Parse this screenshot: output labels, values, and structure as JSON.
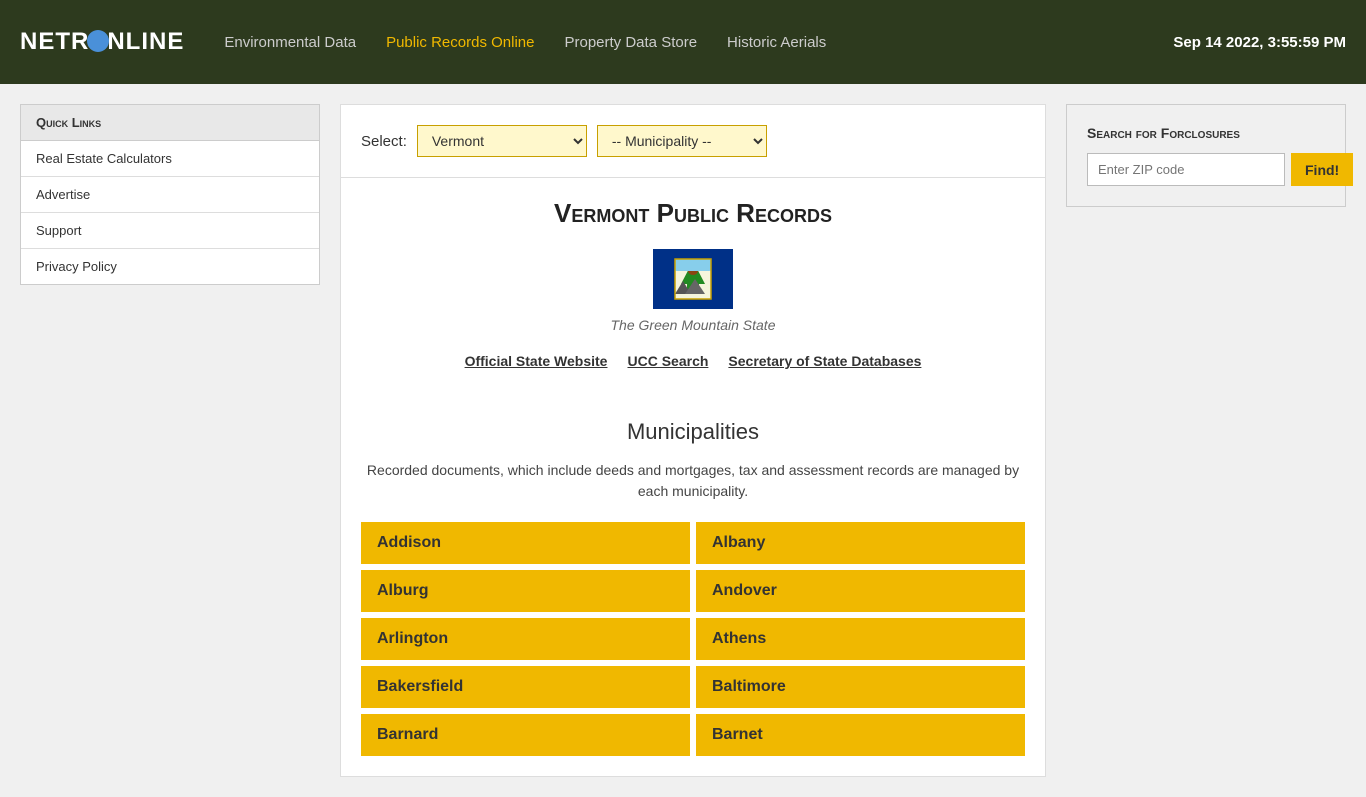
{
  "header": {
    "logo": "NETRONLINE",
    "datetime": "Sep 14 2022, 3:55:59 PM",
    "nav": [
      {
        "label": "Environmental Data",
        "active": false
      },
      {
        "label": "Public Records Online",
        "active": true
      },
      {
        "label": "Property Data Store",
        "active": false
      },
      {
        "label": "Historic Aerials",
        "active": false
      }
    ]
  },
  "sidebar": {
    "title": "Quick Links",
    "items": [
      {
        "label": "Real Estate Calculators"
      },
      {
        "label": "Advertise"
      },
      {
        "label": "Support"
      },
      {
        "label": "Privacy Policy"
      }
    ]
  },
  "select_bar": {
    "label": "Select:",
    "state_value": "Vermont",
    "municipality_placeholder": "-- Municipality --"
  },
  "state_section": {
    "title": "Vermont Public Records",
    "nickname": "The Green Mountain State",
    "links": [
      {
        "label": "Official State Website"
      },
      {
        "label": "UCC Search"
      },
      {
        "label": "Secretary of State Databases"
      }
    ]
  },
  "municipalities": {
    "title": "Municipalities",
    "description": "Recorded documents, which include deeds and mortgages, tax and assessment records are managed by each municipality.",
    "items": [
      "Addison",
      "Albany",
      "Alburg",
      "Andover",
      "Arlington",
      "Athens",
      "Bakersfield",
      "Baltimore",
      "Barnard",
      "Barnet"
    ]
  },
  "foreclosure": {
    "title": "Search for Forclosures",
    "zip_placeholder": "Enter ZIP code",
    "find_label": "Find!"
  }
}
